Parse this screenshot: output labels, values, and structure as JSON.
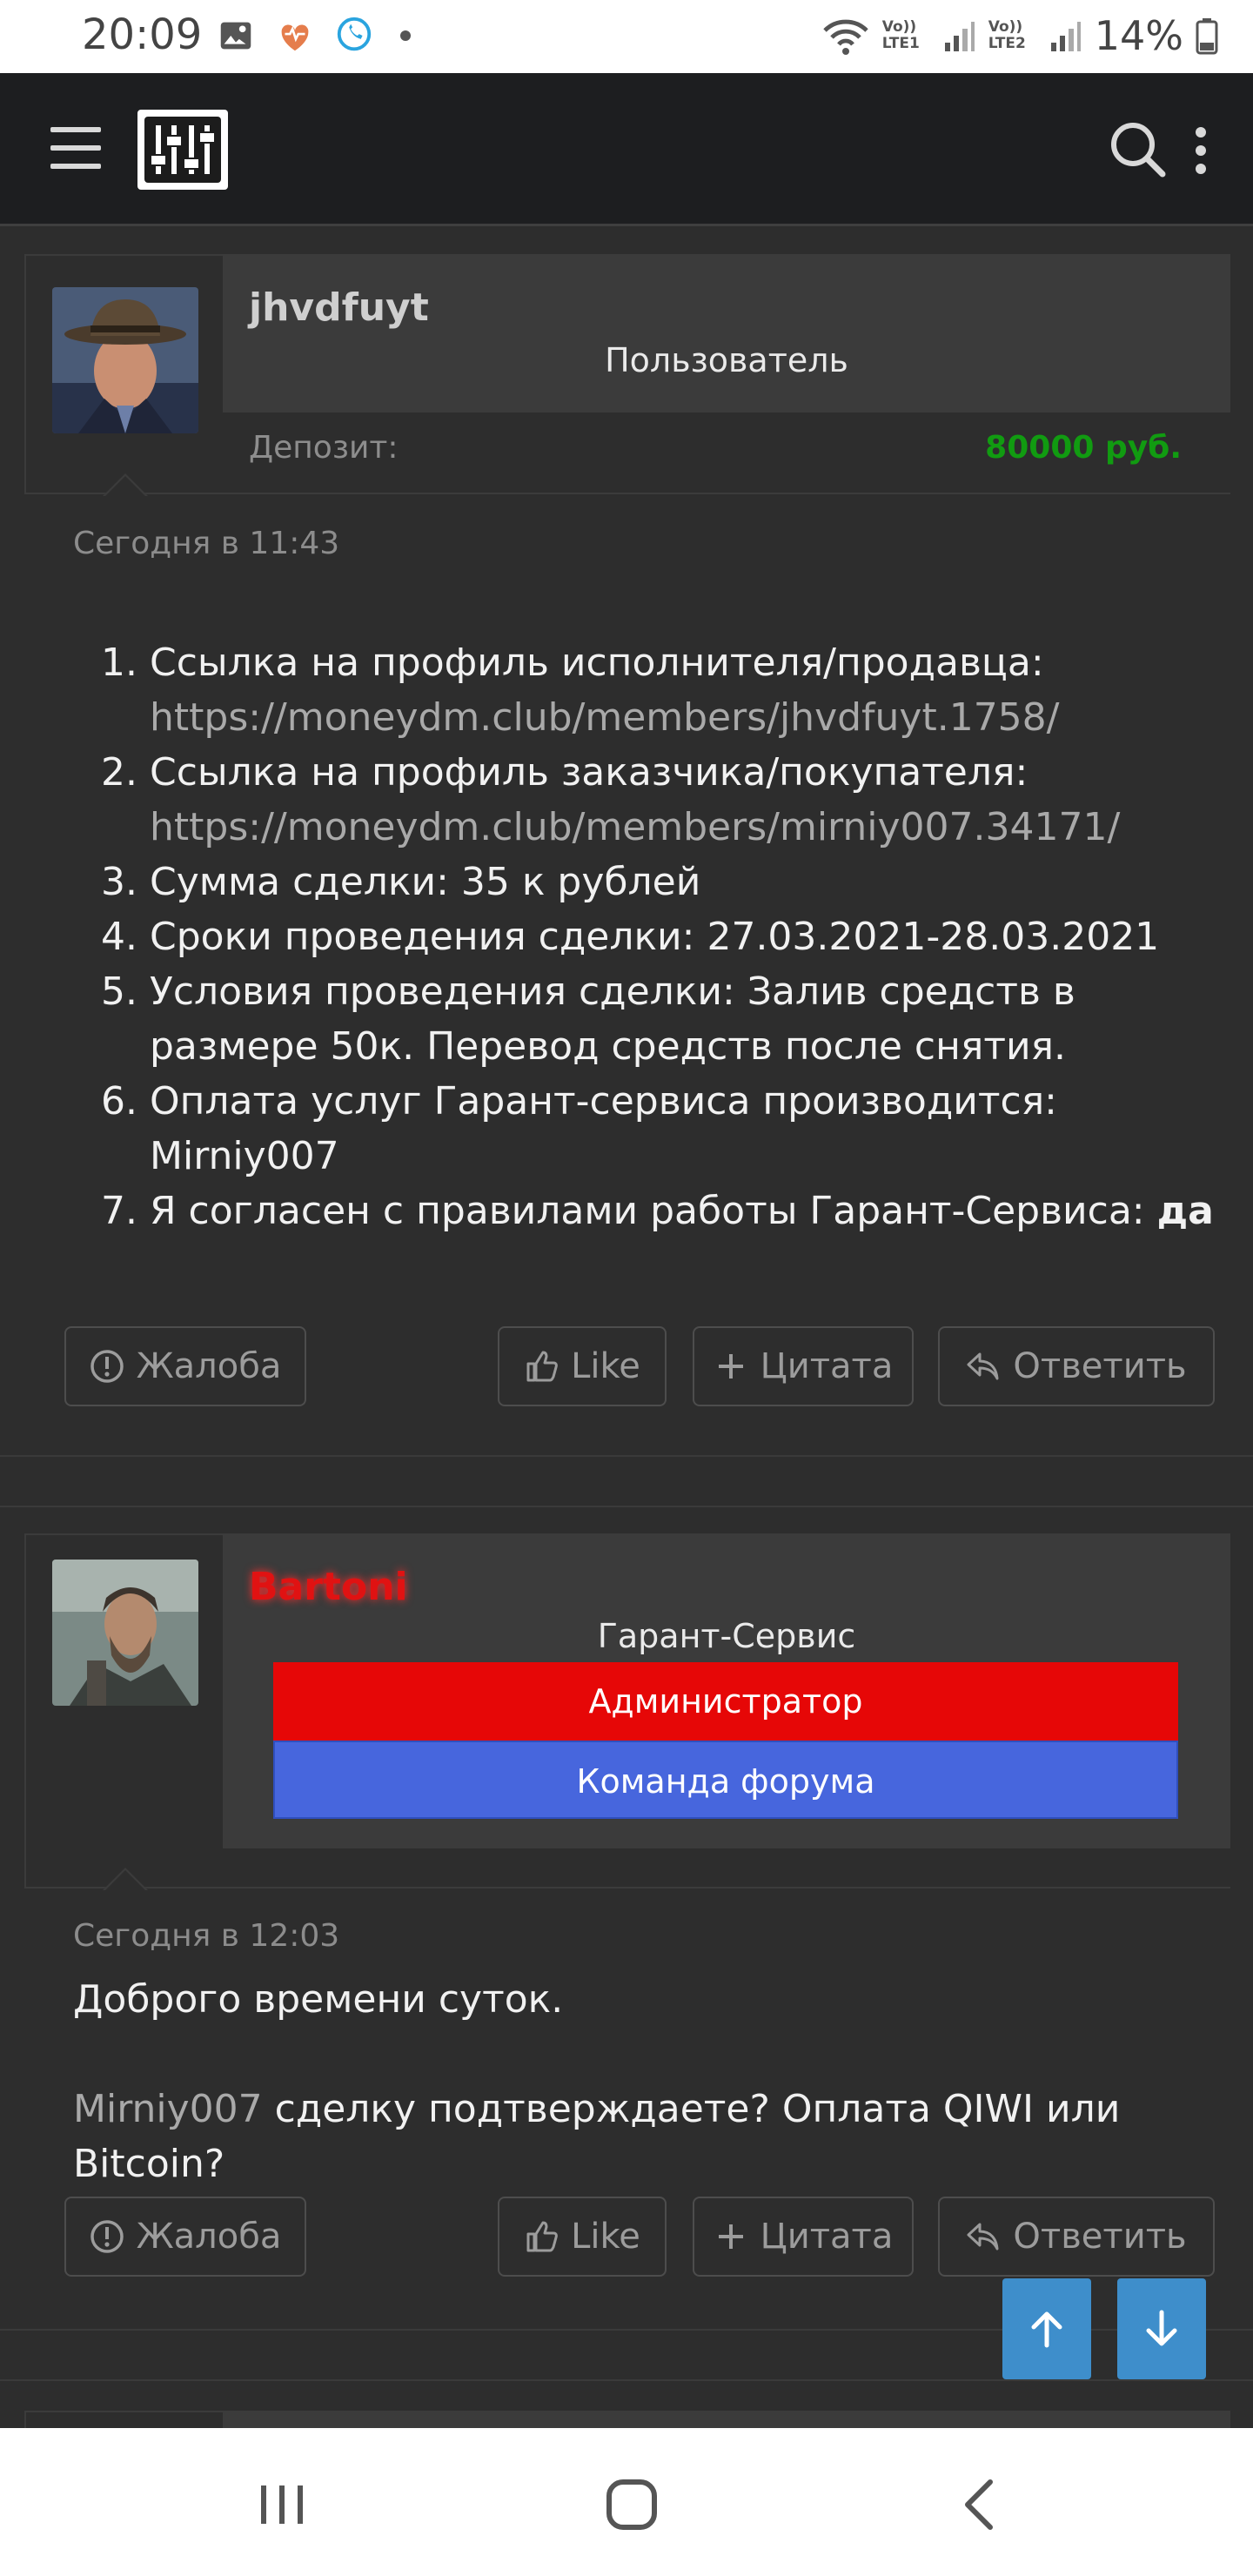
{
  "status_bar": {
    "time": "20:09",
    "sim1": "Vo)) LTE1",
    "sim2": "Vo)) LTE2",
    "battery": "14%"
  },
  "header": {
    "menu_icon": "hamburger-icon",
    "logo_icon": "mixer-sliders-logo",
    "search_icon": "search-icon",
    "more_icon": "vertical-dots-icon"
  },
  "posts": [
    {
      "username": "jhvdfuyt",
      "user_title": "Пользователь",
      "deposit_label": "Депозит:",
      "deposit_value": "80000 руб.",
      "date": "Сегодня в 11:43",
      "items": [
        {
          "text": "Ссылка на профиль исполнителя/продавца:",
          "link": "https://moneydm.club/members/jhvdfuyt.1758/"
        },
        {
          "text": "Ссылка на профиль заказчика/покупателя:",
          "link": "https://moneydm.club/members/mirniy007.34171/"
        },
        {
          "text": "Сумма сделки: 35 к рублей"
        },
        {
          "text": "Сроки проведения сделки: 27.03.2021-28.03.2021"
        },
        {
          "text": "Условия проведения сделки: Залив средств в размере 50к. Перевод средств после снятия."
        },
        {
          "text": "Оплата услуг Гарант-сервиса производится: Mirniy007"
        },
        {
          "text": "Я согласен с правилами работы Гарант-Сервиса: ",
          "bold": "да"
        }
      ],
      "actions": {
        "report": "Жалоба",
        "like": "Like",
        "quote": "Цитата",
        "reply": "Ответить"
      }
    },
    {
      "username": "Bartoni",
      "user_title": "Гарант-Сервис",
      "banner_admin": "Администратор",
      "banner_team": "Команда форума",
      "date": "Сегодня в 12:03",
      "line1": "Доброго времени суток.",
      "mention": "Mirniy007",
      "line2": " сделку подтверждаете? Оплата QIWI или Bitcoin?",
      "actions": {
        "report": "Жалоба",
        "like": "Like",
        "quote": "Цитата",
        "reply": "Ответить"
      }
    }
  ],
  "colors": {
    "background": "#2d2d2d",
    "header": "#1d1e20",
    "deposit_green": "#119b11",
    "admin_red": "#e60707",
    "team_blue": "#4766dd",
    "scroll_button": "#3e8ecb"
  }
}
